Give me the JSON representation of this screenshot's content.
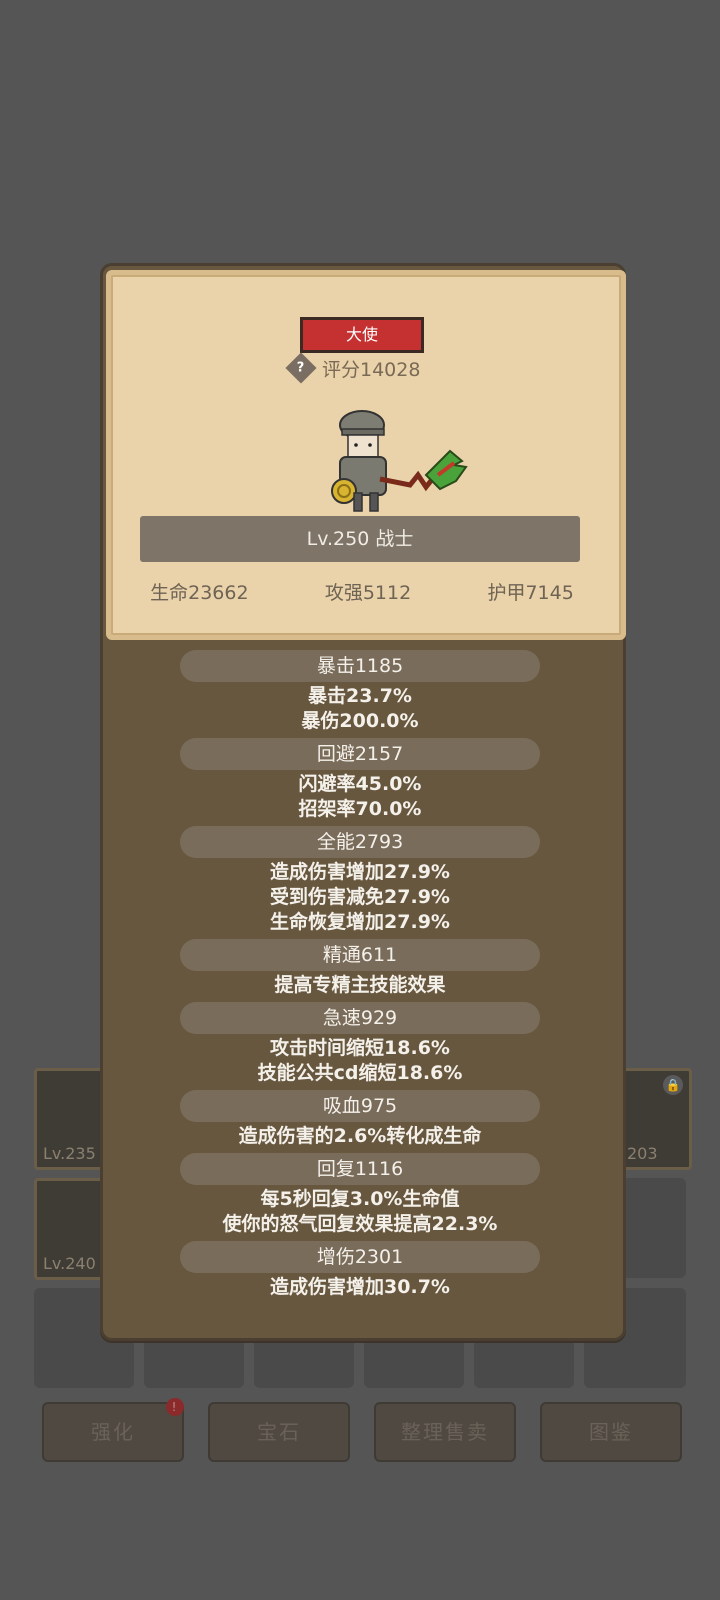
{
  "background": {
    "items": [
      {
        "level": "Lv.235"
      },
      {
        "level": "203"
      },
      {
        "level": "Lv.240"
      }
    ],
    "buttons": [
      {
        "label": "强化",
        "badge": "!"
      },
      {
        "label": "宝石"
      },
      {
        "label": "整理售卖"
      },
      {
        "label": "图鉴"
      }
    ]
  },
  "card": {
    "rank": "大使",
    "score": "评分14028",
    "help_icon": "?",
    "level_class": "Lv.250 战士",
    "stats": [
      "生命23662",
      "攻强5112",
      "护甲7145"
    ]
  },
  "attributes": [
    {
      "title": "暴击1185",
      "lines": [
        "暴击23.7%",
        "暴伤200.0%"
      ]
    },
    {
      "title": "回避2157",
      "lines": [
        "闪避率45.0%",
        "招架率70.0%"
      ]
    },
    {
      "title": "全能2793",
      "lines": [
        "造成伤害增加27.9%",
        "受到伤害减免27.9%",
        "生命恢复增加27.9%"
      ]
    },
    {
      "title": "精通611",
      "lines": [
        "提高专精主技能效果"
      ]
    },
    {
      "title": "急速929",
      "lines": [
        "攻击时间缩短18.6%",
        "技能公共cd缩短18.6%"
      ]
    },
    {
      "title": "吸血975",
      "lines": [
        "造成伤害的2.6%转化成生命"
      ]
    },
    {
      "title": "回复1116",
      "lines": [
        "每5秒回复3.0%生命值",
        "使你的怒气回复效果提高22.3%"
      ]
    },
    {
      "title": "增伤2301",
      "lines": [
        "造成伤害增加30.7%"
      ]
    }
  ]
}
